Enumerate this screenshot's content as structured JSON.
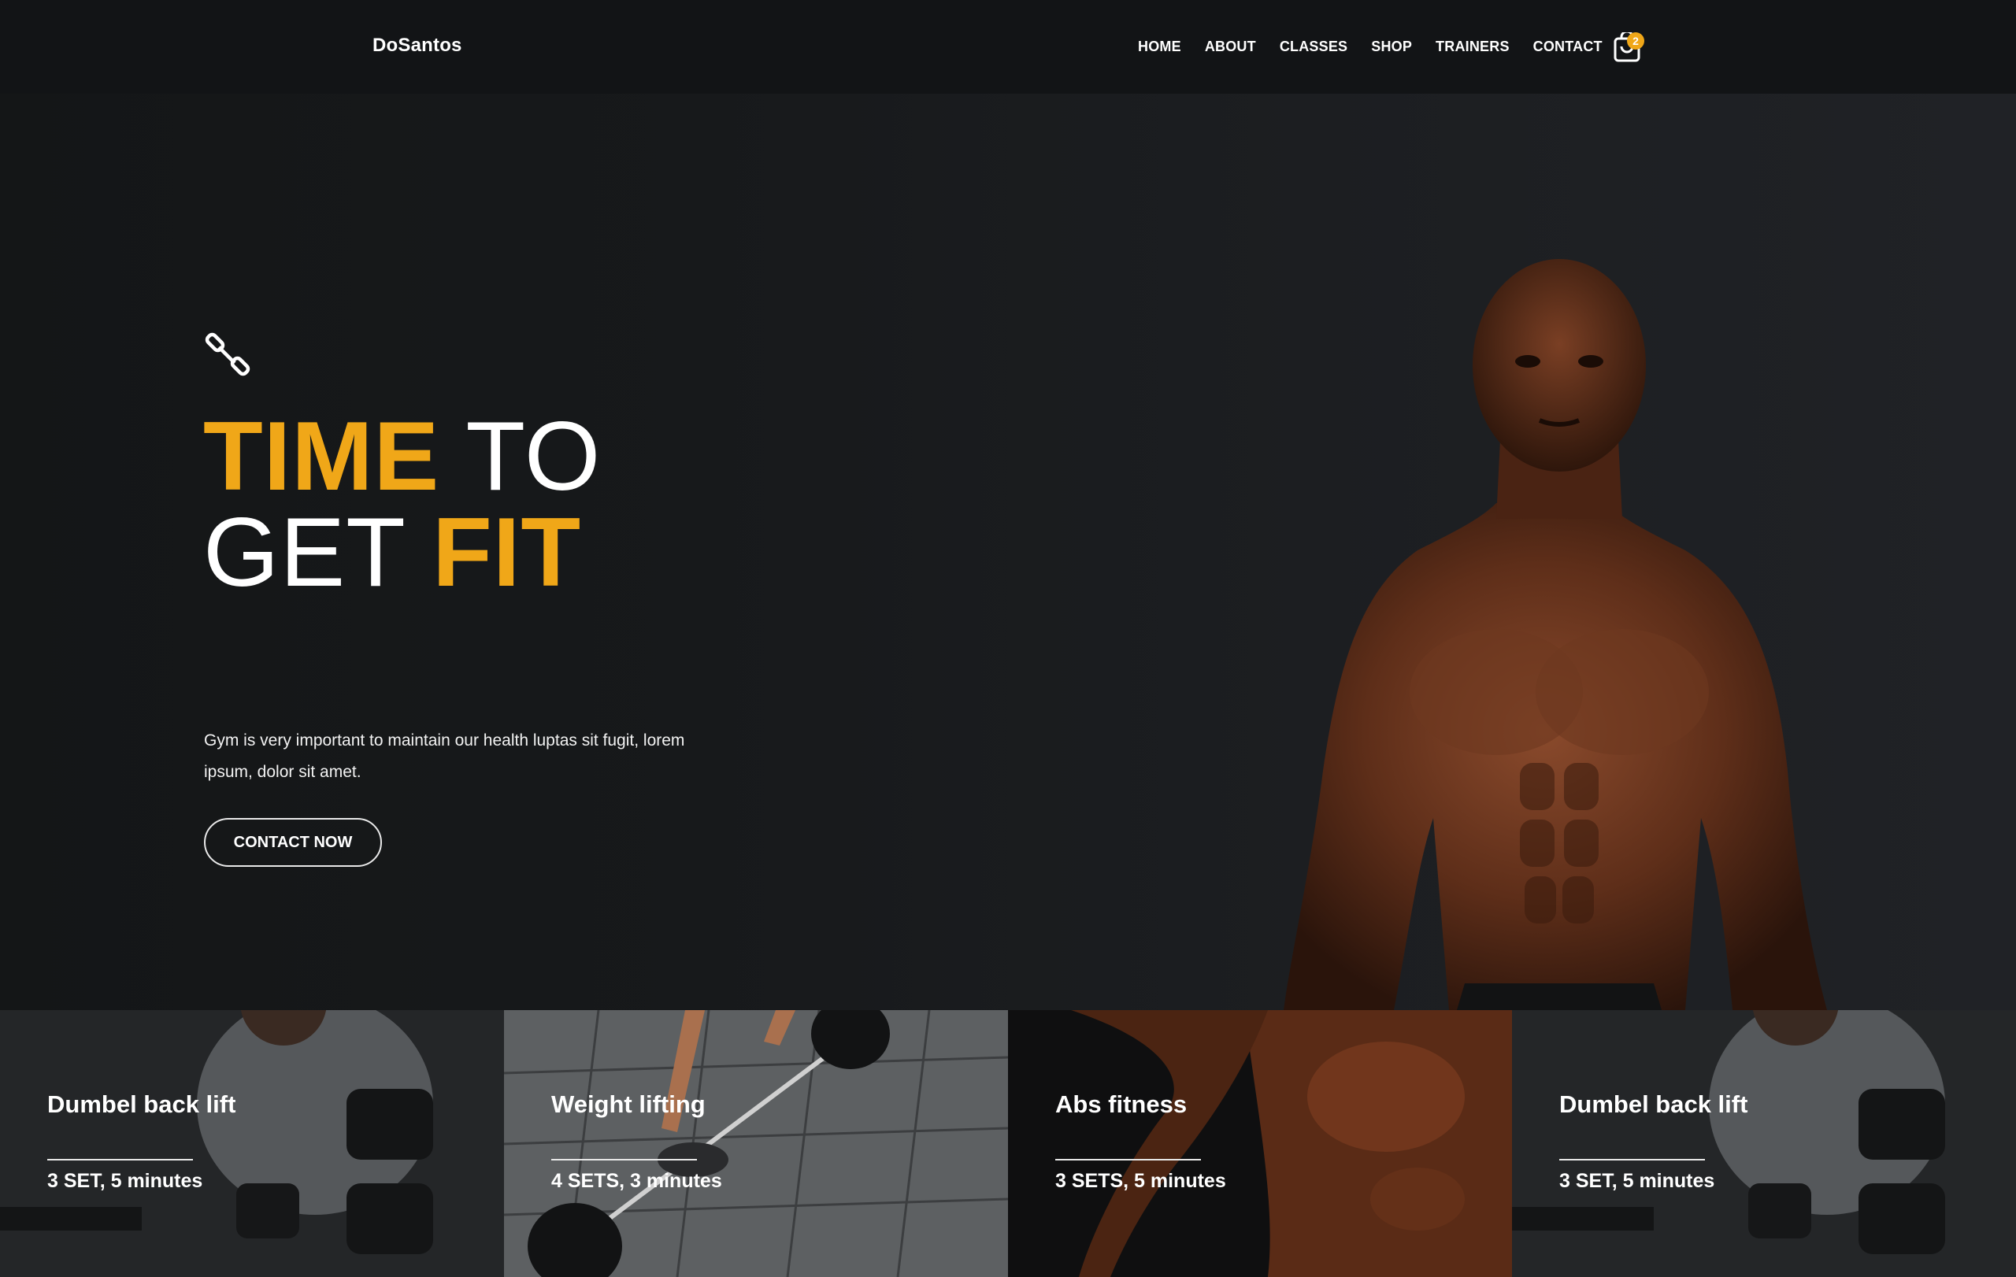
{
  "header": {
    "brand": "DoSantos",
    "nav": [
      "HOME",
      "ABOUT",
      "CLASSES",
      "SHOP",
      "TRAINERS",
      "CONTACT"
    ],
    "cart_count": "2"
  },
  "hero": {
    "headline_word1": "TIME",
    "headline_word2": " TO",
    "headline_word3": "GET ",
    "headline_word4": "FIT",
    "description": "Gym is very important to maintain our health luptas sit fugit, lorem ipsum, dolor sit amet.",
    "cta_label": "CONTACT NOW",
    "accent_color": "#f0a718",
    "floating_button_glyph": "N"
  },
  "cards": [
    {
      "title": "Dumbel back lift",
      "meta": "3 SET, 5 minutes"
    },
    {
      "title": "Weight lifting",
      "meta": "4 SETS, 3 minutes"
    },
    {
      "title": "Abs fitness",
      "meta": "3 SETS, 5 minutes"
    },
    {
      "title": "Dumbel back lift",
      "meta": "3 SET, 5 minutes"
    }
  ]
}
